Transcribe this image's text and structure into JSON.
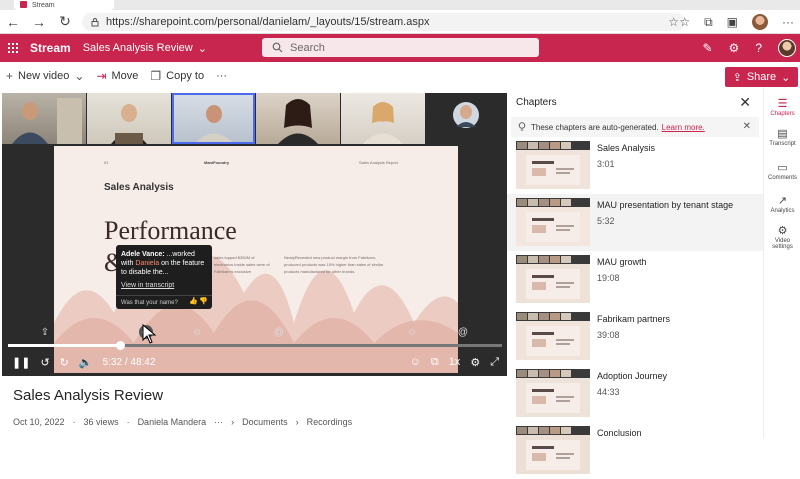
{
  "browser": {
    "tab_title": "Stream",
    "url": "https://sharepoint.com/personal/danielam/_layouts/15/stream.aspx"
  },
  "app_header": {
    "app_name": "Stream",
    "document_title": "Sales Analysis Review",
    "search_placeholder": "Search",
    "accent_color": "#c8254f"
  },
  "command_bar": {
    "new_video": "New video",
    "move": "Move",
    "copy_to": "Copy to",
    "more": "···",
    "share": "Share"
  },
  "video": {
    "slide_heading": "Sales Analysis",
    "slide_big": "Performance",
    "slide_amp": "&",
    "slide_top_left": "01",
    "slide_top_mid": "ManiFoundry",
    "slide_top_right": "Sales Analysis Report",
    "slide_col1": "sales topped $350M of electronics Inside sales were of Fabrikam's exclusive",
    "slide_col2": "NewlyRevealed new product margin from Fabrikam-produced products was 15% higher than sales of similar products manufactured for other brands.",
    "time_current": "5:32",
    "time_total": "48:42",
    "time_display": "5:32 / 48:42",
    "progress_fraction": 0.227,
    "tooltip": {
      "speaker": "Adele Vance:",
      "text_before": " ...worked with ",
      "highlight": "Daniela",
      "text_after": " on the feature to disable the...",
      "link": "View in transcript",
      "question": "Was that your name?"
    }
  },
  "video_info": {
    "title": "Sales Analysis Review",
    "date": "Oct 10, 2022",
    "views": "36 views",
    "author": "Daniela Mandera",
    "ellipsis": "···",
    "crumb1": "Documents",
    "crumb2": "Recordings",
    "sep1": "·",
    "sep2": "·"
  },
  "chapters_panel": {
    "title": "Chapters",
    "notice": "These chapters are auto-generated.",
    "learn_more": "Learn more.",
    "items": [
      {
        "title": "Sales Analysis",
        "time": "3:01"
      },
      {
        "title": "MAU presentation by tenant stage",
        "time": "5:32"
      },
      {
        "title": "MAU growth",
        "time": "19:08"
      },
      {
        "title": "Fabrikam partners",
        "time": "39:08"
      },
      {
        "title": "Adoption Journey",
        "time": "44:33"
      },
      {
        "title": "Conclusion",
        "time": ""
      }
    ]
  },
  "right_rail": {
    "chapters": "Chapters",
    "transcript": "Transcript",
    "comments": "Comments",
    "analytics": "Analytics",
    "video_settings": "Video settings"
  }
}
